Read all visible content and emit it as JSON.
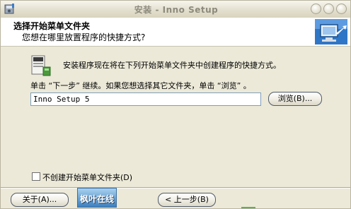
{
  "window": {
    "title": "安装 - Inno Setup"
  },
  "header": {
    "title": "选择开始菜单文件夹",
    "subtitle": "您想在哪里放置程序的快捷方式?"
  },
  "body": {
    "intro": "安装程序现在将在下列开始菜单文件夹中创建程序的快捷方式。",
    "hint": "单击 “下一步” 继续。如果您想选择其它文件夹，单击 “浏览” 。",
    "folder_value": "Inno Setup 5",
    "browse_label": "浏览(B)...",
    "no_folder_label": "不创建开始菜单文件夹(D)"
  },
  "footer": {
    "about_label": "关于(A)...",
    "back_label": "< 上一步(B)",
    "badge_text": "枫叶在线"
  },
  "colors": {
    "window_bg": "#ece9d8",
    "button_border": "#4f5a6a",
    "badge_blue": "#6aa3d4"
  },
  "icons": {
    "app": "setup-disk-icon",
    "header": "computer-arrow-icon",
    "folder": "program-folder-icon"
  }
}
